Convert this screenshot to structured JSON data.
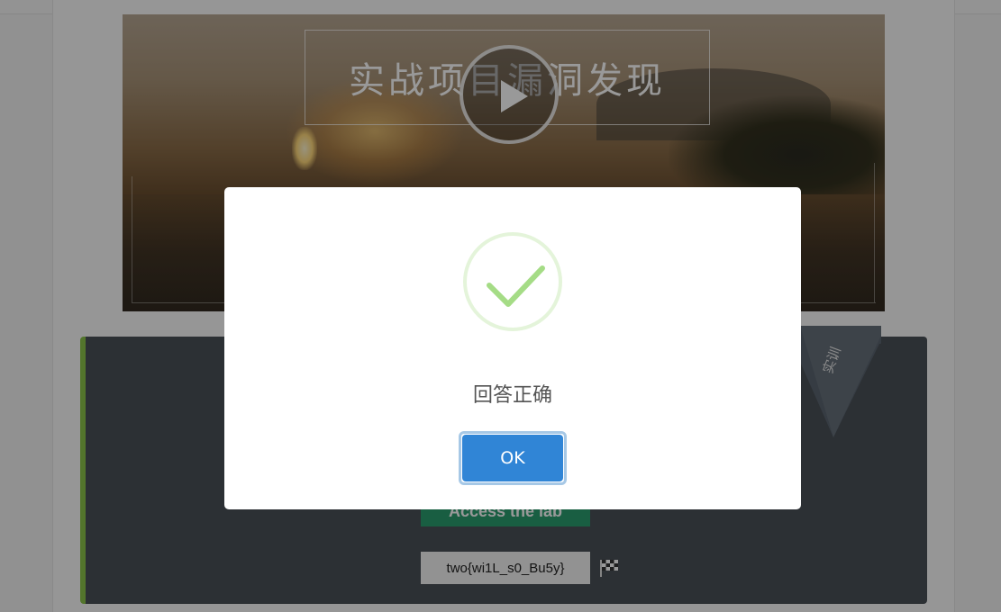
{
  "video": {
    "title": "实战项目漏洞发现",
    "play_icon": "play-icon"
  },
  "card": {
    "ribbon_label": "实训",
    "access_button": "Access the lab",
    "flag_value": "two{wi1L_s0_Bu5y}",
    "flag_icon": "checkered-flag-icon",
    "accent_color": "#8bc34a"
  },
  "modal": {
    "icon": "success-check-icon",
    "message": "回答正确",
    "ok_label": "OK",
    "check_color": "#a5dc86",
    "button_color": "#3085d6"
  }
}
